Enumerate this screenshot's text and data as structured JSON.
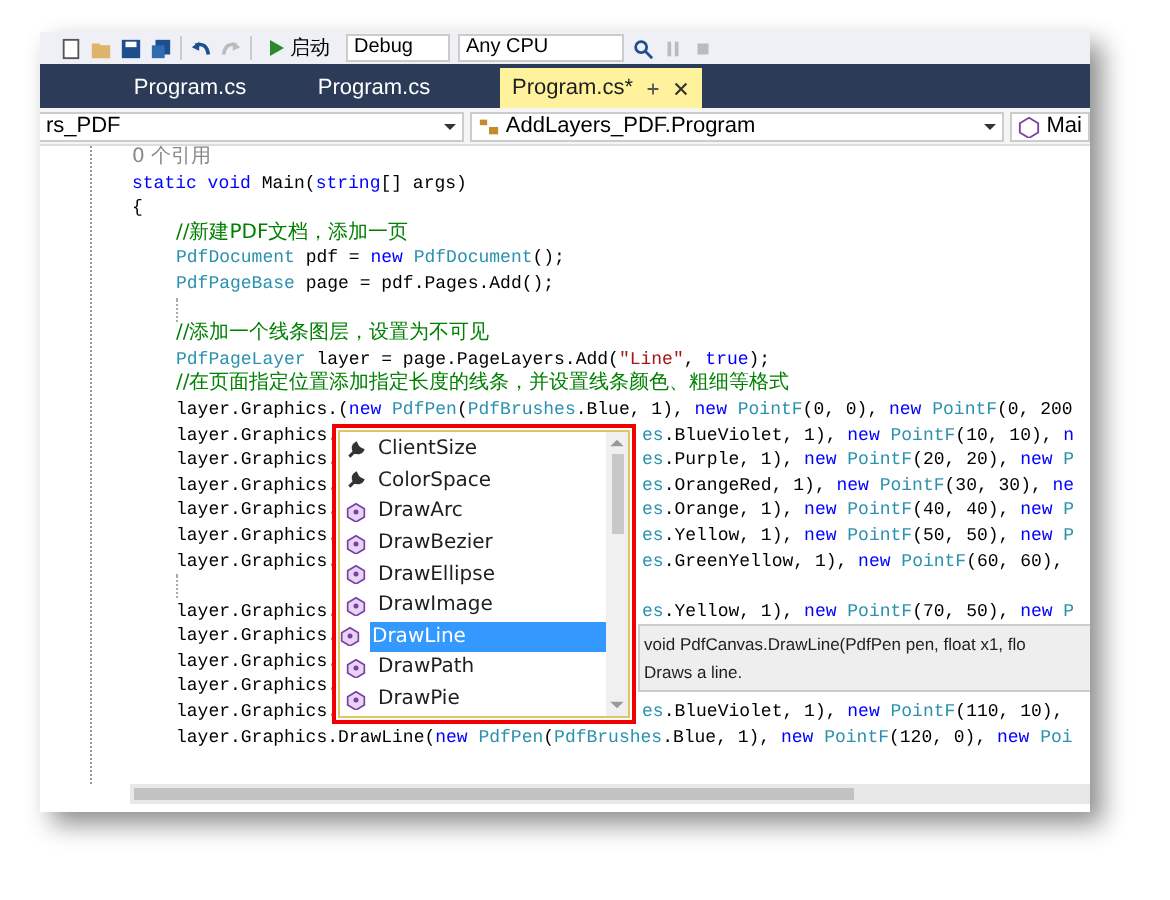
{
  "toolbar": {
    "start_button": "启动",
    "configuration": "Debug",
    "platform": "Any CPU"
  },
  "tabs": [
    {
      "label": "Program.cs",
      "selected": false
    },
    {
      "label": "Program.cs",
      "selected": false
    },
    {
      "label": "Program.cs*",
      "selected": true
    }
  ],
  "navigation": [
    {
      "label": "rs_PDF",
      "kind": "plain"
    },
    {
      "label": "AddLayers_PDF.Program",
      "kind": "class"
    },
    {
      "label": "Mai",
      "kind": "method"
    }
  ],
  "method": {
    "reference_count": "0 个引用",
    "signature": [
      {
        "kind": "kw",
        "text": "static"
      },
      {
        "kind": "kw",
        "text": " void"
      },
      {
        "kind": "plain",
        "text": " Main("
      },
      {
        "kind": "kw",
        "text": "string"
      },
      {
        "kind": "plain",
        "text": "[] args)"
      }
    ],
    "brace": "{",
    "body": [
      {
        "kind": "code",
        "tokens": [
          {
            "kind": "comment",
            "text": "//新建PDF文档，添加一页"
          }
        ]
      },
      {
        "kind": "code",
        "tokens": [
          {
            "kind": "type",
            "text": "PdfDocument"
          },
          {
            "kind": "plain",
            "text": " pdf ="
          },
          {
            "kind": "kw",
            "text": " new"
          },
          {
            "kind": "type",
            "text": " PdfDocument"
          },
          {
            "kind": "plain",
            "text": "();"
          }
        ]
      },
      {
        "kind": "code",
        "tokens": [
          {
            "kind": "type",
            "text": "PdfPageBase"
          },
          {
            "kind": "plain",
            "text": " page = pdf.Pages.Add();"
          }
        ]
      },
      {
        "kind": "blank"
      },
      {
        "kind": "code",
        "tokens": [
          {
            "kind": "comment",
            "text": "//添加一个线条图层，设置为不可见"
          }
        ]
      },
      {
        "kind": "code",
        "tokens": [
          {
            "kind": "type",
            "text": "PdfPageLayer"
          },
          {
            "kind": "plain",
            "text": " layer = page.PageLayers.Add("
          },
          {
            "kind": "str",
            "text": "\"Line\""
          },
          {
            "kind": "plain",
            "text": ","
          },
          {
            "kind": "kw",
            "text": " true"
          },
          {
            "kind": "plain",
            "text": ");"
          }
        ]
      },
      {
        "kind": "code",
        "tokens": [
          {
            "kind": "comment",
            "text": "//在页面指定位置添加指定长度的线条，并设置线条颜色、粗细等格式"
          }
        ]
      },
      {
        "kind": "code",
        "tokens": [
          {
            "kind": "plain",
            "text": "layer.Graphics.("
          },
          {
            "kind": "kw",
            "text": "new"
          },
          {
            "kind": "type",
            "text": " PdfPen"
          },
          {
            "kind": "plain",
            "text": "("
          },
          {
            "kind": "type",
            "text": "PdfBrushes"
          },
          {
            "kind": "plain",
            "text": ".Blue, 1),"
          },
          {
            "kind": "kw",
            "text": " new"
          },
          {
            "kind": "type",
            "text": " PointF"
          },
          {
            "kind": "plain",
            "text": "(0, 0),"
          },
          {
            "kind": "kw",
            "text": " new"
          },
          {
            "kind": "type",
            "text": " PointF"
          },
          {
            "kind": "plain",
            "text": "(0, 200"
          }
        ]
      },
      {
        "kind": "covered",
        "left": [
          {
            "kind": "plain",
            "text": "layer.Graphics."
          }
        ],
        "right": [
          {
            "kind": "type",
            "text": "es"
          },
          {
            "kind": "plain",
            "text": ".BlueViolet, 1),"
          },
          {
            "kind": "kw",
            "text": " new"
          },
          {
            "kind": "type",
            "text": " PointF"
          },
          {
            "kind": "plain",
            "text": "(10, 10),"
          },
          {
            "kind": "kw",
            "text": " n"
          }
        ]
      },
      {
        "kind": "covered",
        "left": [
          {
            "kind": "plain",
            "text": "layer.Graphics."
          }
        ],
        "right": [
          {
            "kind": "type",
            "text": "es"
          },
          {
            "kind": "plain",
            "text": ".Purple, 1),"
          },
          {
            "kind": "kw",
            "text": " new"
          },
          {
            "kind": "type",
            "text": " PointF"
          },
          {
            "kind": "plain",
            "text": "(20, 20),"
          },
          {
            "kind": "kw",
            "text": " new"
          },
          {
            "kind": "type",
            "text": " P"
          }
        ]
      },
      {
        "kind": "covered",
        "left": [
          {
            "kind": "plain",
            "text": "layer.Graphics."
          }
        ],
        "right": [
          {
            "kind": "type",
            "text": "es"
          },
          {
            "kind": "plain",
            "text": ".OrangeRed, 1),"
          },
          {
            "kind": "kw",
            "text": " new"
          },
          {
            "kind": "type",
            "text": " PointF"
          },
          {
            "kind": "plain",
            "text": "(30, 30),"
          },
          {
            "kind": "kw",
            "text": " ne"
          }
        ]
      },
      {
        "kind": "covered",
        "left": [
          {
            "kind": "plain",
            "text": "layer.Graphics."
          }
        ],
        "right": [
          {
            "kind": "type",
            "text": "es"
          },
          {
            "kind": "plain",
            "text": ".Orange, 1),"
          },
          {
            "kind": "kw",
            "text": " new"
          },
          {
            "kind": "type",
            "text": " PointF"
          },
          {
            "kind": "plain",
            "text": "(40, 40),"
          },
          {
            "kind": "kw",
            "text": " new"
          },
          {
            "kind": "type",
            "text": " P"
          }
        ]
      },
      {
        "kind": "covered",
        "left": [
          {
            "kind": "plain",
            "text": "layer.Graphics."
          }
        ],
        "right": [
          {
            "kind": "type",
            "text": "es"
          },
          {
            "kind": "plain",
            "text": ".Yellow, 1),"
          },
          {
            "kind": "kw",
            "text": " new"
          },
          {
            "kind": "type",
            "text": " PointF"
          },
          {
            "kind": "plain",
            "text": "(50, 50),"
          },
          {
            "kind": "kw",
            "text": " new"
          },
          {
            "kind": "type",
            "text": " P"
          }
        ]
      },
      {
        "kind": "covered",
        "left": [
          {
            "kind": "plain",
            "text": "layer.Graphics."
          }
        ],
        "right": [
          {
            "kind": "type",
            "text": "es"
          },
          {
            "kind": "plain",
            "text": ".GreenYellow, 1),"
          },
          {
            "kind": "kw",
            "text": " new"
          },
          {
            "kind": "type",
            "text": " PointF"
          },
          {
            "kind": "plain",
            "text": "(60, 60),"
          }
        ]
      },
      {
        "kind": "blank"
      },
      {
        "kind": "covered",
        "left": [
          {
            "kind": "plain",
            "text": "layer.Graphics."
          }
        ],
        "right": [
          {
            "kind": "type",
            "text": "es"
          },
          {
            "kind": "plain",
            "text": ".Yellow, 1),"
          },
          {
            "kind": "kw",
            "text": " new"
          },
          {
            "kind": "type",
            "text": " PointF"
          },
          {
            "kind": "plain",
            "text": "(70, 50),"
          },
          {
            "kind": "kw",
            "text": " new"
          },
          {
            "kind": "type",
            "text": " P"
          }
        ]
      },
      {
        "kind": "covered",
        "left": [
          {
            "kind": "plain",
            "text": "layer.Graphics."
          }
        ]
      },
      {
        "kind": "covered",
        "left": [
          {
            "kind": "plain",
            "text": "layer.Graphics."
          }
        ]
      },
      {
        "kind": "covered",
        "left": [
          {
            "kind": "plain",
            "text": "layer.Graphics."
          }
        ]
      },
      {
        "kind": "covered",
        "left": [
          {
            "kind": "plain",
            "text": "layer.Graphics."
          }
        ],
        "right": [
          {
            "kind": "type",
            "text": "es"
          },
          {
            "kind": "plain",
            "text": ".BlueViolet, 1),"
          },
          {
            "kind": "kw",
            "text": " new"
          },
          {
            "kind": "type",
            "text": " PointF"
          },
          {
            "kind": "plain",
            "text": "(110, 10),"
          }
        ]
      },
      {
        "kind": "code",
        "tokens": [
          {
            "kind": "plain",
            "text": "layer.Graphics.DrawLine("
          },
          {
            "kind": "kw",
            "text": "new"
          },
          {
            "kind": "type",
            "text": " PdfPen"
          },
          {
            "kind": "plain",
            "text": "("
          },
          {
            "kind": "type",
            "text": "PdfBrushes"
          },
          {
            "kind": "plain",
            "text": ".Blue, 1),"
          },
          {
            "kind": "kw",
            "text": " new"
          },
          {
            "kind": "type",
            "text": " PointF"
          },
          {
            "kind": "plain",
            "text": "(120, 0),"
          },
          {
            "kind": "kw",
            "text": " new"
          },
          {
            "kind": "type",
            "text": " Poi"
          }
        ]
      }
    ]
  },
  "completion": {
    "items": [
      {
        "label": "ClientSize",
        "kind": "property",
        "selected": false
      },
      {
        "label": "ColorSpace",
        "kind": "property",
        "selected": false
      },
      {
        "label": "DrawArc",
        "kind": "method",
        "selected": false
      },
      {
        "label": "DrawBezier",
        "kind": "method",
        "selected": false
      },
      {
        "label": "DrawEllipse",
        "kind": "method",
        "selected": false
      },
      {
        "label": "DrawImage",
        "kind": "method",
        "selected": false
      },
      {
        "label": "DrawLine",
        "kind": "method",
        "selected": true
      },
      {
        "label": "DrawPath",
        "kind": "method",
        "selected": false
      },
      {
        "label": "DrawPie",
        "kind": "method",
        "selected": false
      }
    ]
  },
  "tooltip": {
    "signature": "void PdfCanvas.DrawLine(PdfPen pen, float x1, flo",
    "description": "Draws a line."
  }
}
